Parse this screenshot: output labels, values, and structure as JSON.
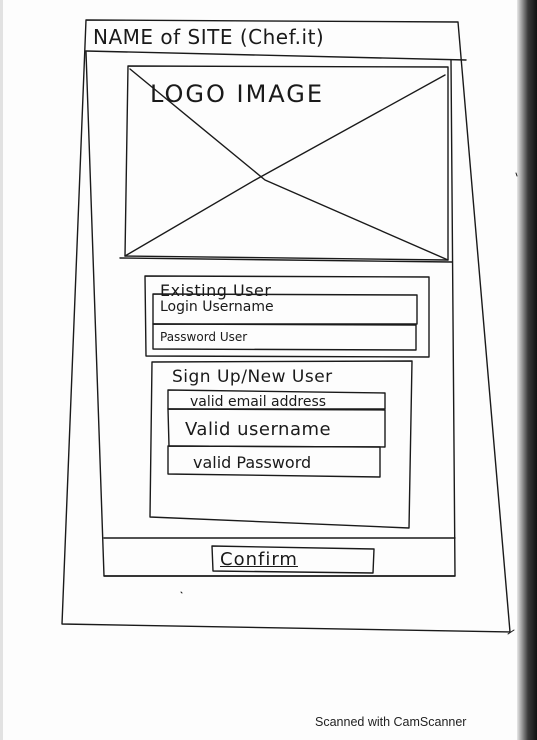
{
  "header": {
    "site_name": "NAME of SITE (Chef.it)"
  },
  "logo": {
    "placeholder_text": "LOGO IMAGE"
  },
  "existing_user": {
    "title": "Existing User",
    "username_field": "Login Username",
    "password_field": "Password User"
  },
  "signup": {
    "title": "Sign Up/New User",
    "email_field": "valid email address",
    "username_field": "Valid username",
    "password_field": "valid Password"
  },
  "footer": {
    "confirm_label": "Confirm"
  },
  "scanner": {
    "watermark": "Scanned with CamScanner"
  },
  "colors": {
    "ink": "#1a1a1a",
    "paper": "#fdfdfd"
  }
}
